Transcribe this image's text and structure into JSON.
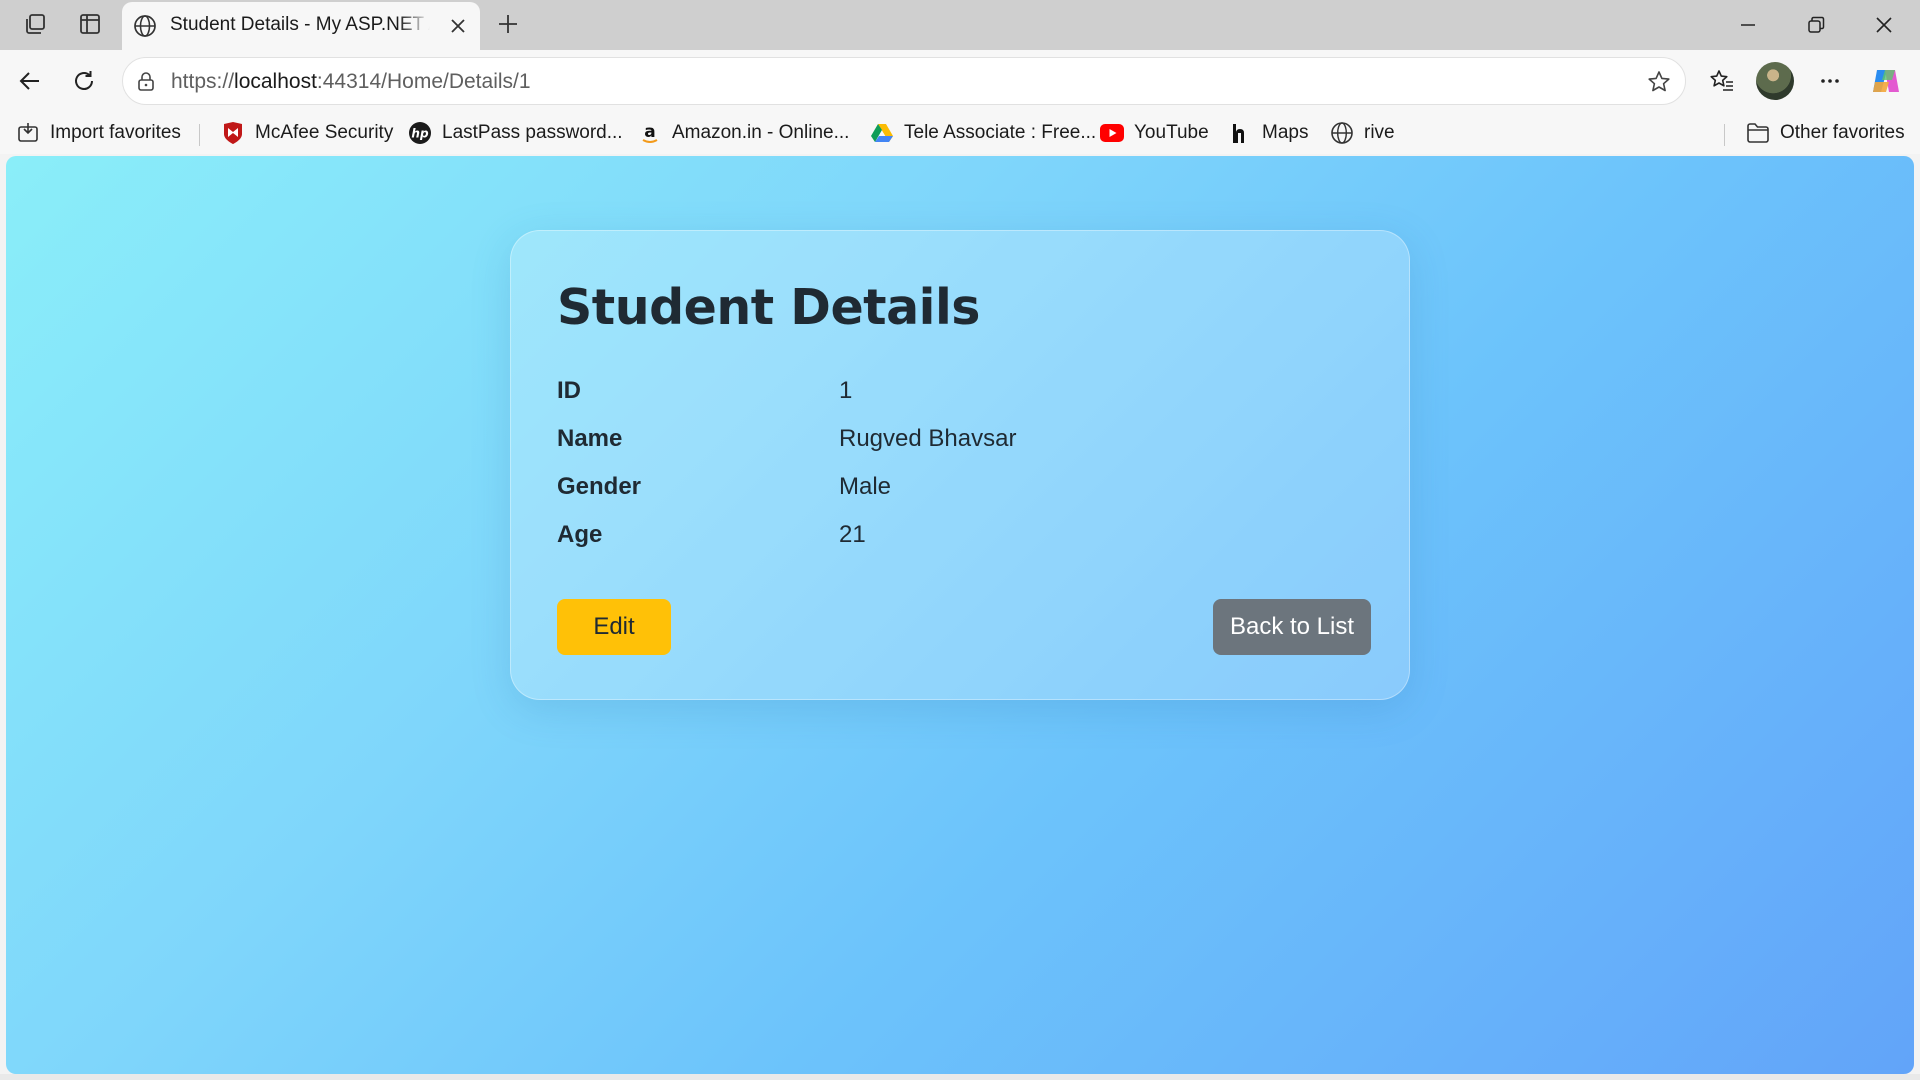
{
  "browser": {
    "tab": {
      "title": "Student Details - My ASP.NET Application"
    },
    "address": {
      "scheme": "https://",
      "host": "localhost",
      "rest": ":44314/Home/Details/1"
    },
    "favorites": [
      {
        "label": "Import favorites",
        "icon": "import-icon"
      },
      {
        "label": "McAfee Security",
        "icon": "mcafee-icon"
      },
      {
        "label": "LastPass password...",
        "icon": "hp-icon"
      },
      {
        "label": "Amazon.in - Online...",
        "icon": "amazon-icon"
      },
      {
        "label": "Tele Associate : Free...",
        "icon": "google-drive-icon"
      },
      {
        "label": "YouTube",
        "icon": "youtube-icon"
      },
      {
        "label": "Maps",
        "icon": "maps-icon"
      },
      {
        "label": "rive",
        "icon": "globe-icon"
      }
    ],
    "other_favorites": "Other favorites"
  },
  "page": {
    "title": "Student Details",
    "fields": [
      {
        "label": "ID",
        "value": "1"
      },
      {
        "label": "Name",
        "value": "Rugved Bhavsar"
      },
      {
        "label": "Gender",
        "value": "Male"
      },
      {
        "label": "Age",
        "value": "21"
      }
    ],
    "edit_label": "Edit",
    "back_label": "Back to List"
  },
  "colors": {
    "edit_button": "#ffc107",
    "back_button": "#6c757d",
    "gradient_start": "#8aeef9",
    "gradient_end": "#62a4f9"
  }
}
